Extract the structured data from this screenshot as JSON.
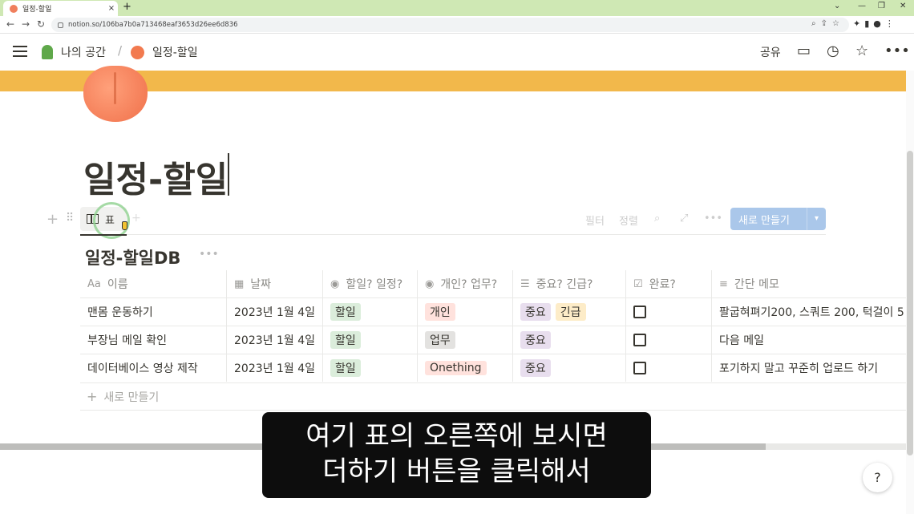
{
  "browser": {
    "tab_title": "일정-할일",
    "tab_close": "×",
    "new_tab": "+",
    "url": "notion.so/106ba7b0a713468eaf3653d26ee6d836",
    "back": "←",
    "forward": "→",
    "reload": "↻",
    "win_min": "⌄",
    "win_min2": "—",
    "win_restore": "❐",
    "win_close": "✕"
  },
  "topbar": {
    "workspace": "나의 공간",
    "separator": "/",
    "page": "일정-할일",
    "share": "공유"
  },
  "page": {
    "title": "일정-할일"
  },
  "view": {
    "tab_label": "표",
    "filter": "필터",
    "sort": "정렬",
    "new_button": "새로 만들기"
  },
  "database": {
    "title": "일정-할일DB",
    "columns": [
      {
        "icon": "Aa",
        "label": "이름"
      },
      {
        "icon": "▦",
        "label": "날짜"
      },
      {
        "icon": "◉",
        "label": "할일? 일정?"
      },
      {
        "icon": "◉",
        "label": "개인? 업무?"
      },
      {
        "icon": "☰",
        "label": "중요? 긴급?"
      },
      {
        "icon": "☑",
        "label": "완료?"
      },
      {
        "icon": "≡",
        "label": "간단 메모"
      }
    ],
    "rows": [
      {
        "name": "맨몸 운동하기",
        "date": "2023년 1월 4일",
        "type": "할일",
        "category": "개인",
        "priority": [
          "중요",
          "긴급"
        ],
        "done": false,
        "memo": "팔굽혀펴기200, 스쿼트 200, 턱걸이 5"
      },
      {
        "name": "부장님 메일 확인",
        "date": "2023년 1월 4일",
        "type": "할일",
        "category": "업무",
        "priority": [
          "중요"
        ],
        "done": false,
        "memo": "다음 메일"
      },
      {
        "name": "데이터베이스 영상 제작",
        "date": "2023년 1월 4일",
        "type": "할일",
        "category": "Onething",
        "priority": [
          "중요"
        ],
        "done": false,
        "memo": "포기하지 말고 꾸준히 업로드 하기"
      }
    ],
    "add_row": "새로 만들기"
  },
  "subtitle": {
    "line1": "여기 표의 오른쪽에 보시면",
    "line2": "더하기 버튼을 클릭해서"
  },
  "help": "?",
  "colors": {
    "tag_green": "#dbeddb",
    "tag_red": "#ffe2dd",
    "tag_gray": "#e3e2e0",
    "tag_purple": "#e8deee",
    "tag_yellow": "#fdecc8",
    "cover": "#f2b84b",
    "new_button": "#aac7ea"
  }
}
